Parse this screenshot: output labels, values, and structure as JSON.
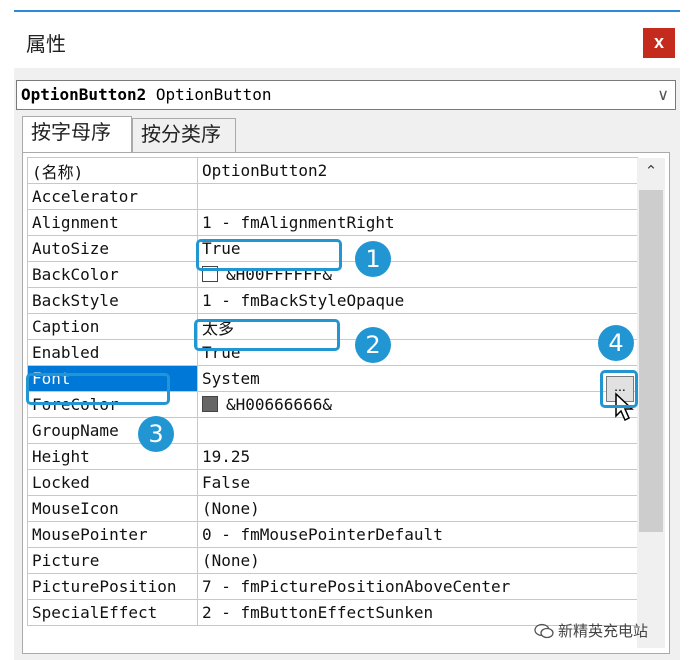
{
  "window": {
    "title": "属性",
    "close_label": "x"
  },
  "object_selector": {
    "object_name": "OptionButton2",
    "object_type": "OptionButton"
  },
  "tabs": [
    {
      "label": "按字母序"
    },
    {
      "label": "按分类序"
    }
  ],
  "properties": [
    {
      "name": "(名称)",
      "value": "OptionButton2"
    },
    {
      "name": "Accelerator",
      "value": ""
    },
    {
      "name": "Alignment",
      "value": "1 - fmAlignmentRight"
    },
    {
      "name": "AutoSize",
      "value": "True"
    },
    {
      "name": "BackColor",
      "value": "&H00FFFFFF&",
      "swatch": "#ffffff"
    },
    {
      "name": "BackStyle",
      "value": "1 - fmBackStyleOpaque"
    },
    {
      "name": "Caption",
      "value": "太多"
    },
    {
      "name": "Enabled",
      "value": "True"
    },
    {
      "name": "Font",
      "value": "System"
    },
    {
      "name": "ForeColor",
      "value": "&H00666666&",
      "swatch": "#666666"
    },
    {
      "name": "GroupName",
      "value": ""
    },
    {
      "name": "Height",
      "value": "19.25"
    },
    {
      "name": "Locked",
      "value": "False"
    },
    {
      "name": "MouseIcon",
      "value": "(None)"
    },
    {
      "name": "MousePointer",
      "value": "0 - fmMousePointerDefault"
    },
    {
      "name": "Picture",
      "value": "(None)"
    },
    {
      "name": "PicturePosition",
      "value": "7 - fmPicturePositionAboveCenter"
    },
    {
      "name": "SpecialEffect",
      "value": "2 - fmButtonEffectSunken"
    }
  ],
  "selected_property": "Font",
  "font_button_label": "...",
  "annotations": [
    "1",
    "2",
    "3",
    "4"
  ],
  "accent_color": "#2196d3",
  "watermark": "新精英充电站"
}
